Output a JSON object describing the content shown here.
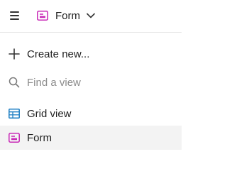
{
  "header": {
    "current_view": "Form",
    "menu_icon": "hamburger-menu-icon",
    "view_icon": "form-icon",
    "dropdown_icon": "chevron-down-icon"
  },
  "menu": {
    "create_label": "Create new...",
    "search": {
      "placeholder": "Find a view",
      "value": ""
    },
    "views": [
      {
        "label": "Grid view",
        "icon": "grid-icon",
        "icon_color": "#1d7fc4",
        "selected": false
      },
      {
        "label": "Form",
        "icon": "form-icon",
        "icon_color": "#c828b6",
        "selected": true
      }
    ]
  },
  "colors": {
    "form_accent": "#c828b6",
    "grid_accent": "#1d7fc4",
    "selected_row_bg": "#f3f3f3"
  }
}
